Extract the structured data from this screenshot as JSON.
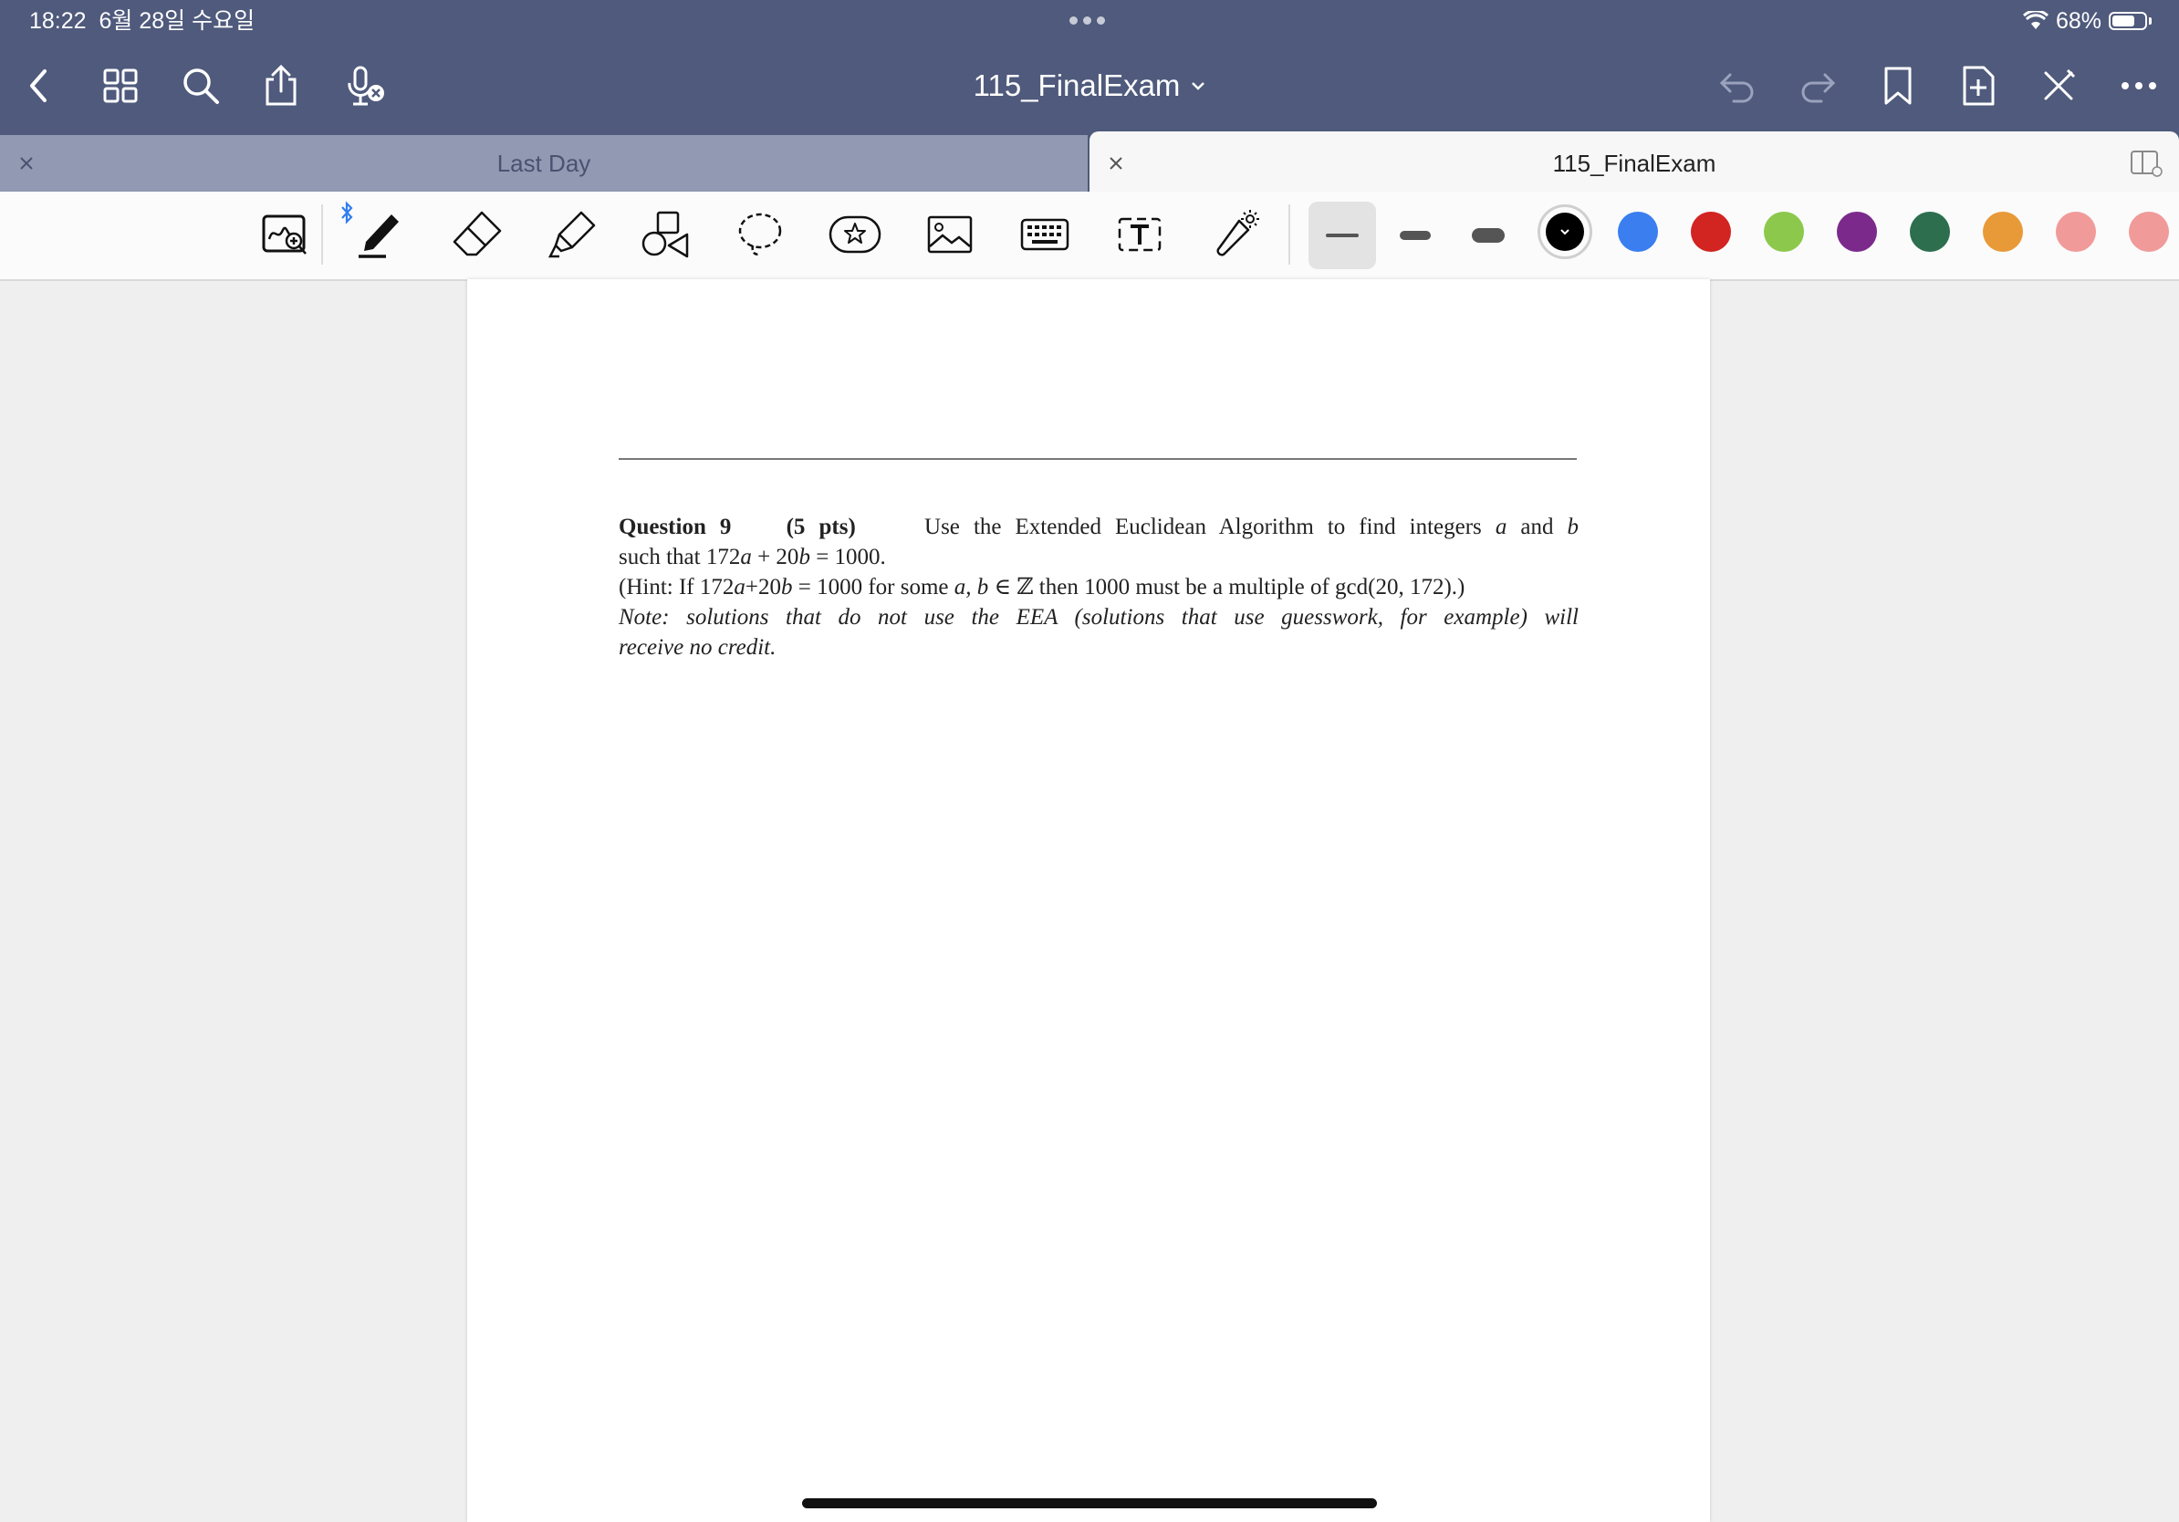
{
  "status_bar": {
    "time": "18:22",
    "date": "6월 28일 수요일",
    "battery": "68%"
  },
  "header": {
    "title": "115_FinalExam"
  },
  "tabs": [
    {
      "label": "Last Day",
      "active": false
    },
    {
      "label": "115_FinalExam",
      "active": true
    }
  ],
  "toolbar": {
    "tools": [
      "zoom-window",
      "pen",
      "eraser",
      "highlighter",
      "shapes",
      "lasso",
      "sticker",
      "image",
      "keyboard",
      "text-box",
      "laser-pointer"
    ],
    "stroke_widths": [
      "thin",
      "medium",
      "thick"
    ],
    "colors": [
      "#000000",
      "#3a7ef0",
      "#d22420",
      "#8cc84b",
      "#7b2a8c",
      "#2d6e4f",
      "#e89a38",
      "#f19a9a",
      "#f19a9a"
    ]
  },
  "document": {
    "question_num": "Question 9",
    "points": "(5 pts)",
    "l1_a": "Use the Extended Euclidean Algorithm to find integers ",
    "var_a": "a",
    "and": " and ",
    "var_b": "b",
    "l2_a": "such that 172",
    "plus20": " + 20",
    "eq1000": " = 1000.",
    "l3_a": "(Hint: If 172",
    "plus20b": "+20",
    "l3_b": " = 1000 for some ",
    "ab_set": "a, b",
    "l3_c": " ∈ ℤ then 1000 must be a multiple of gcd(20, 172).)",
    "note_1": "Note: solutions that do not use the EEA (solutions that use guesswork, for example) will",
    "note_2": "receive no credit."
  }
}
